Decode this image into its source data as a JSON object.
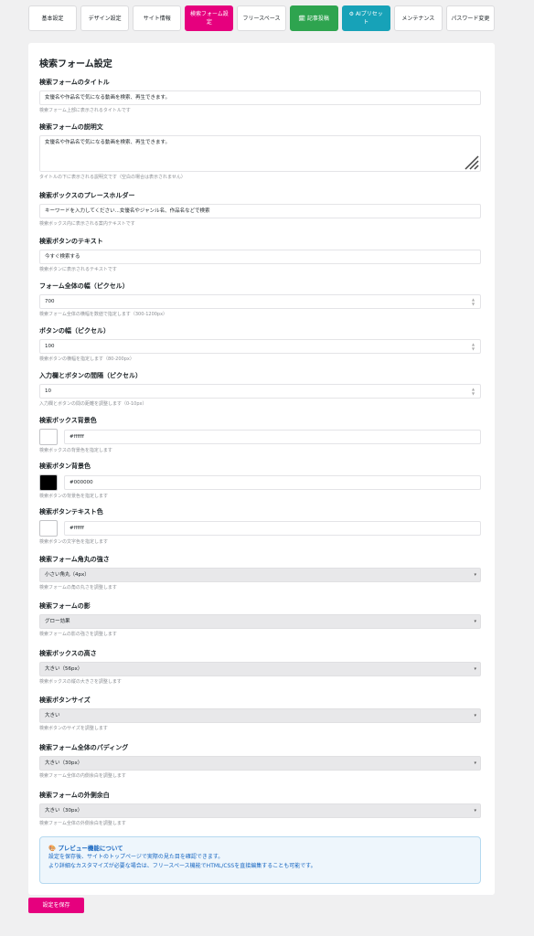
{
  "tabs": [
    {
      "label": "基本設定"
    },
    {
      "label": "デザイン設定"
    },
    {
      "label": "サイト情報"
    },
    {
      "label": "検索フォーム設定"
    },
    {
      "label": "フリースペース"
    },
    {
      "label": "🗓 記事投稿"
    },
    {
      "label": "⚙ AIプリセット"
    },
    {
      "label": "メンテナンス"
    },
    {
      "label": "パスワード変更"
    }
  ],
  "panel": {
    "title": "検索フォーム設定"
  },
  "fields": {
    "title": {
      "label": "検索フォームのタイトル",
      "value": "女優名や作品名で気になる動画を検索、再生できます。",
      "hint": "検索フォーム上部に表示されるタイトルです"
    },
    "desc": {
      "label": "検索フォームの説明文",
      "value": "女優名や作品名で気になる動画を検索、再生できます。",
      "hint": "タイトルの下に表示される説明文です（空白の場合は表示されません）"
    },
    "placeholder": {
      "label": "検索ボックスのプレースホルダー",
      "value": "キーワードを入力してください...女優名やジャンル名、作品名などで検索",
      "hint": "検索ボックス内に表示される案内テキストです"
    },
    "button_text": {
      "label": "検索ボタンのテキスト",
      "value": "今すぐ検索する",
      "hint": "検索ボタンに表示されるテキストです"
    },
    "form_width": {
      "label": "フォーム全体の幅（ピクセル）",
      "value": "700",
      "hint": "検索フォーム全体の横幅を数値で指定します（300-1200px）"
    },
    "button_width": {
      "label": "ボタンの幅（ピクセル）",
      "value": "100",
      "hint": "検索ボタンの横幅を指定します（80-200px）"
    },
    "gap": {
      "label": "入力欄とボタンの間隔（ピクセル）",
      "value": "10",
      "hint": "入力欄とボタンの間の距離を調整します（0-10px）"
    },
    "box_bg": {
      "label": "検索ボックス背景色",
      "value": "#ffffff",
      "hint": "検索ボックスの背景色を指定します"
    },
    "btn_bg": {
      "label": "検索ボタン背景色",
      "value": "#000000",
      "hint": "検索ボタンの背景色を指定します"
    },
    "btn_text_color": {
      "label": "検索ボタンテキスト色",
      "value": "#ffffff",
      "hint": "検索ボタンの文字色を指定します"
    },
    "radius": {
      "label": "検索フォーム角丸の強さ",
      "value": "小さい角丸（4px）",
      "hint": "検索フォームの角の丸さを調整します"
    },
    "shadow": {
      "label": "検索フォームの影",
      "value": "グロー効果",
      "hint": "検索フォームの影の強さを調整します"
    },
    "box_height": {
      "label": "検索ボックスの高さ",
      "value": "大きい（56px）",
      "hint": "検索ボックスの縦の大きさを調整します"
    },
    "button_size": {
      "label": "検索ボタンサイズ",
      "value": "大きい",
      "hint": "検索ボタンのサイズを調整します"
    },
    "padding": {
      "label": "検索フォーム全体のパディング",
      "value": "大きい（30px）",
      "hint": "検索フォーム全体の内側余白を調整します"
    },
    "margin": {
      "label": "検索フォームの外側余白",
      "value": "大きい（30px）",
      "hint": "検索フォーム全体の外側余白を調整します"
    }
  },
  "swatch_colors": {
    "box_bg": "#ffffff",
    "btn_bg": "#000000",
    "btn_text_color": "#ffffff"
  },
  "accent": "#e6007e",
  "info": {
    "title": "🎨 プレビュー機能について",
    "line1": "設定を保存後、サイトのトップページで実際の見た目を確認できます。",
    "line2": "より詳細なカスタマイズが必要な場合は、フリースペース機能でHTML/CSSを直接編集することも可能です。"
  },
  "save_label": "設定を保存"
}
